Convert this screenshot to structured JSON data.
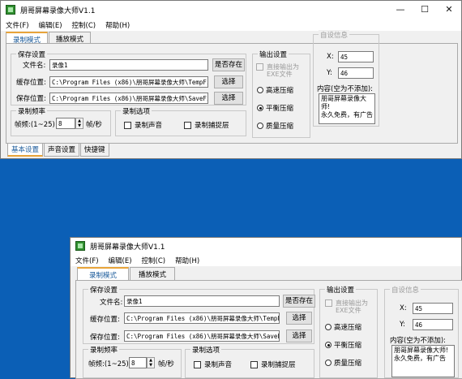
{
  "window": {
    "title": "朋哥屏幕录像大师V1.1",
    "controls": {
      "minimize": "—",
      "maximize": "☐",
      "close": "✕"
    }
  },
  "menu": [
    "文件(F)",
    "编辑(E)",
    "控制(C)",
    "帮助(H)"
  ],
  "tabs": [
    "录制模式",
    "播放模式"
  ],
  "save_settings": {
    "title": "保存设置",
    "filename_label": "文件名:",
    "filename_value": "录像1",
    "exists_button": "是否存在",
    "cache_label": "缓存位置:",
    "cache_value": "C:\\Program Files (x86)\\朋哥屏幕录像大师\\TempFile",
    "save_label": "保存位置:",
    "save_value": "C:\\Program Files (x86)\\朋哥屏幕录像大师\\SaveFile",
    "choose_button": "选择"
  },
  "frame_rate": {
    "title": "录制频率",
    "label": "帧频:(1~25)",
    "value": "8",
    "unit": "帧/秒"
  },
  "record_options": {
    "title": "录制选项",
    "record_sound": "录制声音",
    "record_layer": "录制捕捉层"
  },
  "output": {
    "title": "输出设置",
    "direct": "直接输出为EXE文件",
    "high": "高速压缩",
    "balanced": "平衡压缩",
    "quality": "质量压缩"
  },
  "watermark": {
    "title": "自设信息",
    "x_label": "X:",
    "x_value": "45",
    "y_label": "Y:",
    "y_value": "46",
    "content_label": "内容(空为不添加):",
    "content_value": "朋哥屏幕录像大师!\n永久免费，有广告"
  },
  "bottom_tabs": [
    "基本设置",
    "声音设置",
    "快捷键"
  ]
}
